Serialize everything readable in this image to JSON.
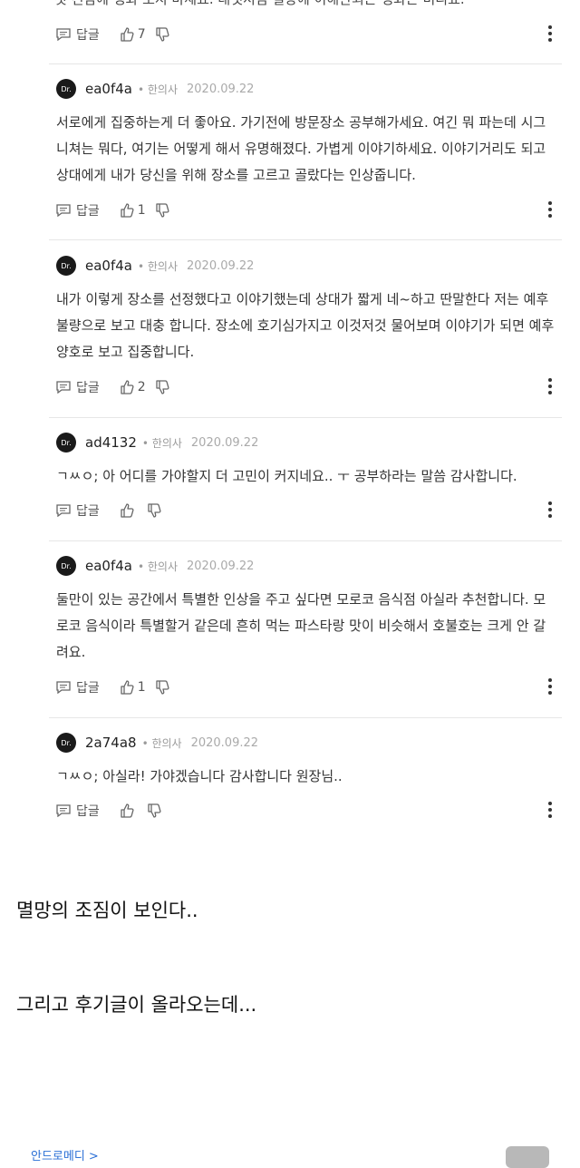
{
  "top_clipped_text": "것 진짬에 맹화 보지 마세요. 대뎃처럼 밀장에 이해관되는 맹화는 비리죠.",
  "top_actions": {
    "reply_label": "답글",
    "like_count": "7"
  },
  "comments": [
    {
      "avatar": "Dr.",
      "username": "ea0f4a",
      "role": "• 한의사",
      "date": "2020.09.22",
      "text": "서로에게 집중하는게 더 좋아요. 가기전에 방문장소 공부해가세요. 여긴 뭐 파는데 시그니쳐는 뭐다, 여기는 어떻게 해서 유명해졌다. 가볍게 이야기하세요. 이야기거리도 되고 상대에게 내가 당신을 위해 장소를 고르고 골랐다는 인상줍니다.",
      "reply_label": "답글",
      "like_count": "1"
    },
    {
      "avatar": "Dr.",
      "username": "ea0f4a",
      "role": "• 한의사",
      "date": "2020.09.22",
      "text": "내가 이렇게 장소를 선정했다고 이야기했는데 상대가 짧게 네~하고 딴말한다 저는 예후불량으로 보고 대충 합니다. 장소에 호기심가지고 이것저것 물어보며 이야기가 되면 예후양호로 보고 집중합니다.",
      "reply_label": "답글",
      "like_count": "2"
    },
    {
      "avatar": "Dr.",
      "username": "ad4132",
      "role": "• 한의사",
      "date": "2020.09.22",
      "text": "ㄱㅆㅇ; 아 어디를 가야할지 더 고민이 커지네요.. ㅜ 공부하라는 말씀 감사합니다.",
      "reply_label": "답글",
      "like_count": ""
    },
    {
      "avatar": "Dr.",
      "username": "ea0f4a",
      "role": "• 한의사",
      "date": "2020.09.22",
      "text": "둘만이 있는 공간에서 특별한 인상을 주고 싶다면 모로코 음식점 아실라 추천합니다. 모로코 음식이라 특별할거 같은데 흔히 먹는 파스타랑 맛이 비슷해서 호불호는 크게 안 갈려요.",
      "reply_label": "답글",
      "like_count": "1"
    },
    {
      "avatar": "Dr.",
      "username": "2a74a8",
      "role": "• 한의사",
      "date": "2020.09.22",
      "text": "ㄱㅆㅇ; 아실라! 가야겠습니다 감사합니다 원장님..",
      "reply_label": "답글",
      "like_count": ""
    }
  ],
  "caption_1": "멸망의 조짐이 보인다..",
  "caption_2": "그리고 후기글이 올라오는데...",
  "source_link": "안드로메디 >"
}
